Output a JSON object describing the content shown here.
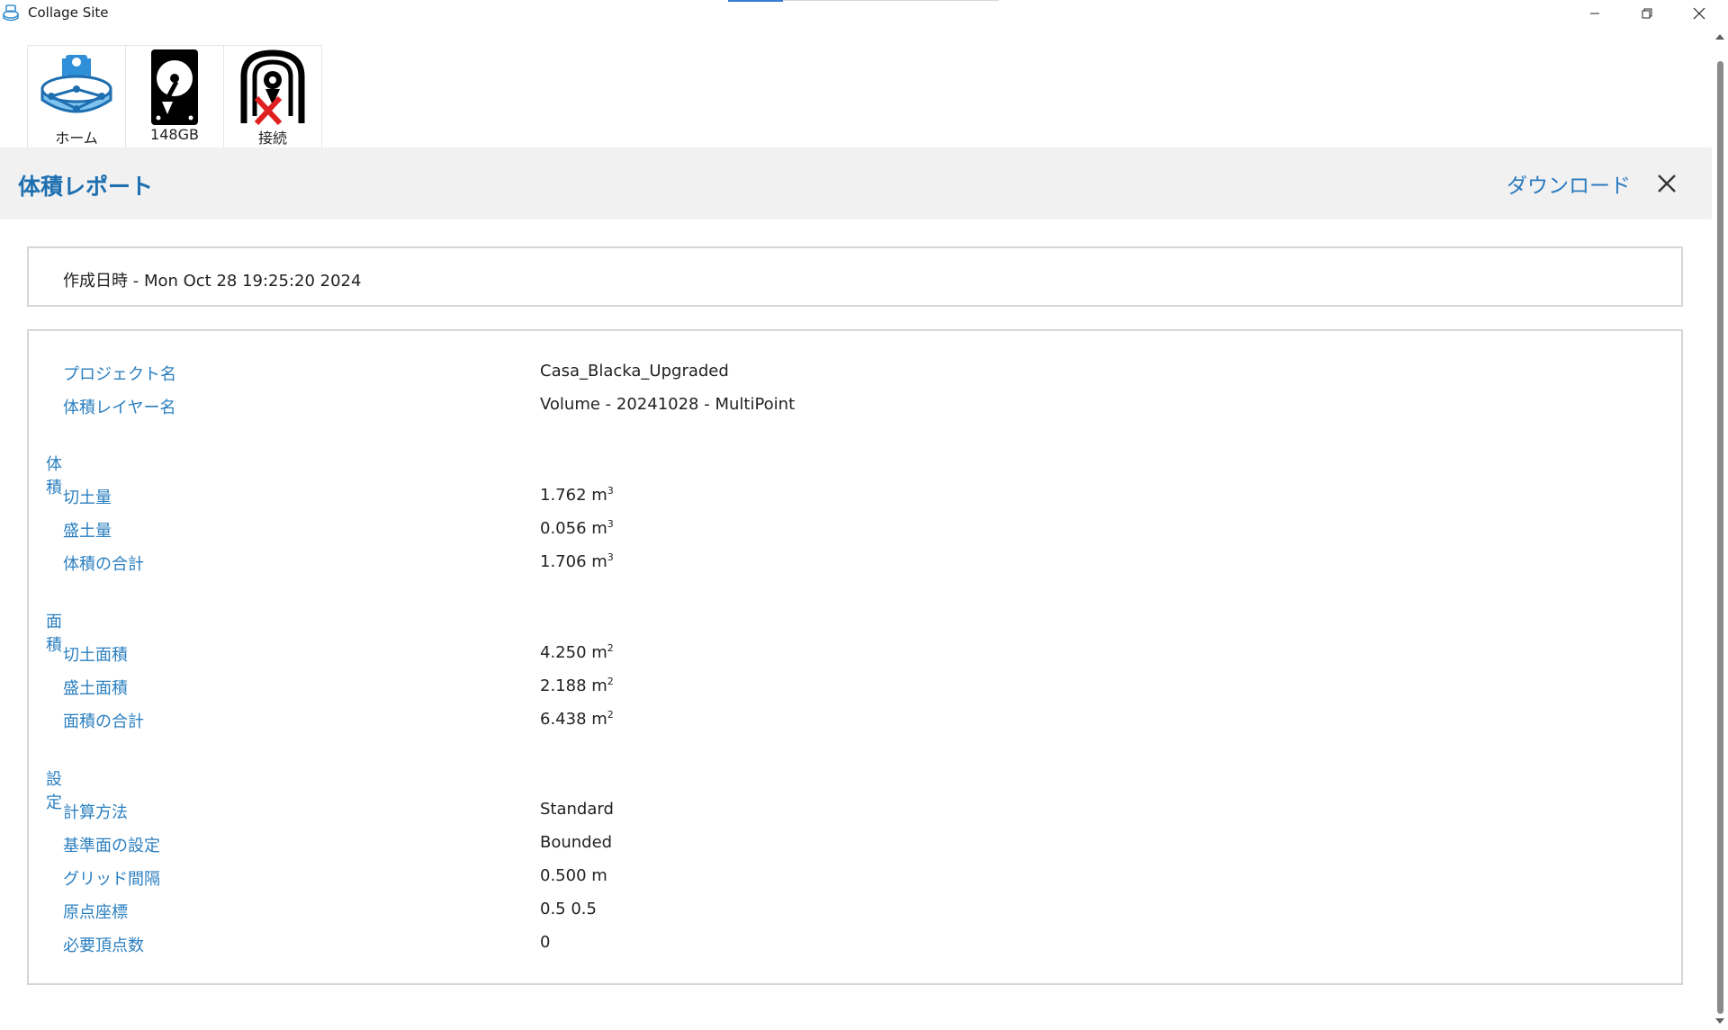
{
  "window": {
    "title": "Collage Site",
    "icons": {
      "app": "site-collage-icon",
      "minimize": "minimize-icon",
      "maximize": "restore-icon",
      "close": "close-icon"
    }
  },
  "toolbar": {
    "items": [
      {
        "label": "ホーム",
        "icon": "home-site-icon"
      },
      {
        "label": "148GB",
        "icon": "storage-drive-icon"
      },
      {
        "label": "接続",
        "icon": "disconnected-receiver-icon"
      }
    ]
  },
  "header": {
    "title": "体積レポート",
    "download_label": "ダウンロード",
    "close_icon": "close-icon",
    "accent_color": "#1e6fb0"
  },
  "report": {
    "created": "作成日時 - Mon Oct 28 19:25:20 2024",
    "project": {
      "label": "プロジェクト名",
      "value": "Casa_Blacka_Upgraded"
    },
    "layer": {
      "label": "体積レイヤー名",
      "value": "Volume - 20241028 - MultiPoint"
    },
    "volume": {
      "heading": "体積",
      "cut": {
        "label": "切土量",
        "value": "1.762 m",
        "unit_exp": "3"
      },
      "fill": {
        "label": "盛土量",
        "value": "0.056 m",
        "unit_exp": "3"
      },
      "total": {
        "label": "体積の合計",
        "value": "1.706 m",
        "unit_exp": "3"
      }
    },
    "area": {
      "heading": "面積",
      "cut": {
        "label": "切土面積",
        "value": "4.250 m",
        "unit_exp": "2"
      },
      "fill": {
        "label": "盛土面積",
        "value": "2.188 m",
        "unit_exp": "2"
      },
      "total": {
        "label": "面積の合計",
        "value": "6.438 m",
        "unit_exp": "2"
      }
    },
    "settings": {
      "heading": "設定",
      "method": {
        "label": "計算方法",
        "value": "Standard"
      },
      "base": {
        "label": "基準面の設定",
        "value": "Bounded"
      },
      "grid": {
        "label": "グリッド間隔",
        "value": "0.500 m"
      },
      "origin": {
        "label": "原点座標",
        "value": "0.5 0.5"
      },
      "points": {
        "label": "必要頂点数",
        "value": "0"
      }
    }
  }
}
